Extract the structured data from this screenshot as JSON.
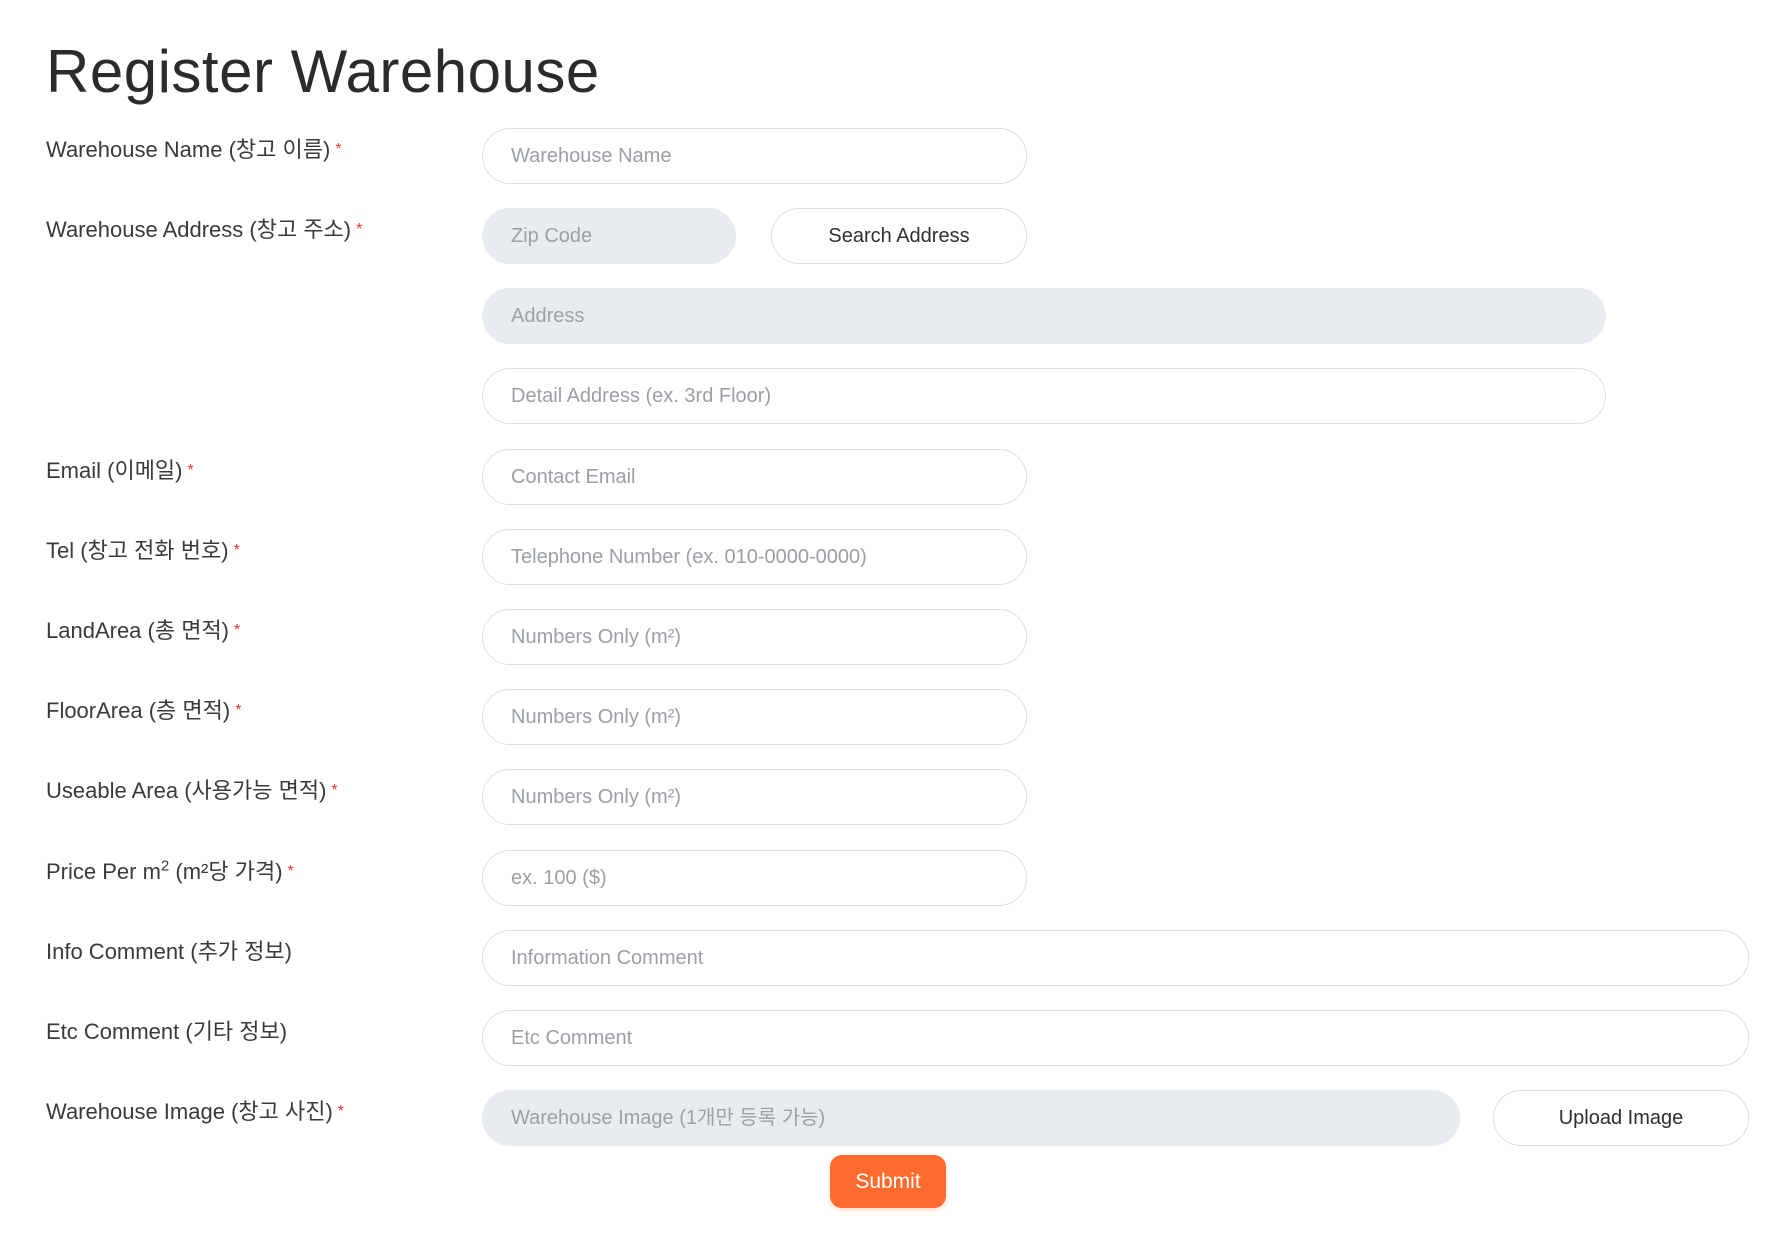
{
  "page": {
    "title": "Register Warehouse"
  },
  "required_mark": "*",
  "fields": {
    "warehouse_name": {
      "label": "Warehouse Name (창고 이름)",
      "placeholder": "Warehouse Name",
      "value": ""
    },
    "warehouse_address": {
      "label": "Warehouse Address (창고 주소)",
      "zip_placeholder": "Zip Code",
      "search_button_label": "Search Address",
      "address_placeholder": "Address",
      "detail_placeholder": "Detail Address (ex. 3rd Floor)"
    },
    "email": {
      "label": "Email (이메일)",
      "placeholder": "Contact Email",
      "value": ""
    },
    "tel": {
      "label": "Tel (창고 전화 번호)",
      "placeholder": "Telephone Number (ex. 010-0000-0000)",
      "value": ""
    },
    "land_area": {
      "label": "LandArea (총 면적)",
      "placeholder": "Numbers Only (m²)",
      "value": ""
    },
    "floor_area": {
      "label": "FloorArea (층 면적)",
      "placeholder": "Numbers Only (m²)",
      "value": ""
    },
    "useable_area": {
      "label": "Useable Area (사용가능 면적)",
      "placeholder": "Numbers Only (m²)",
      "value": ""
    },
    "price_per_m2": {
      "label_prefix": "Price Per m",
      "label_sup": "2",
      "label_suffix": " (m²당 가격)",
      "placeholder": "ex. 100 ($)",
      "value": ""
    },
    "info_comment": {
      "label": "Info Comment (추가 정보)",
      "placeholder": "Information Comment",
      "value": ""
    },
    "etc_comment": {
      "label": "Etc Comment (기타 정보)",
      "placeholder": "Etc Comment",
      "value": ""
    },
    "warehouse_image": {
      "label": "Warehouse Image (창고 사진)",
      "placeholder": "Warehouse Image (1개만 등록 가능)",
      "upload_button_label": "Upload Image"
    }
  },
  "submit": {
    "label": "Submit"
  },
  "colors": {
    "accent": "#ff6a2f",
    "required": "#e53935",
    "input_border": "#dcdfe3",
    "readonly_bg": "#e9ecef",
    "placeholder": "#9aa0a6"
  }
}
